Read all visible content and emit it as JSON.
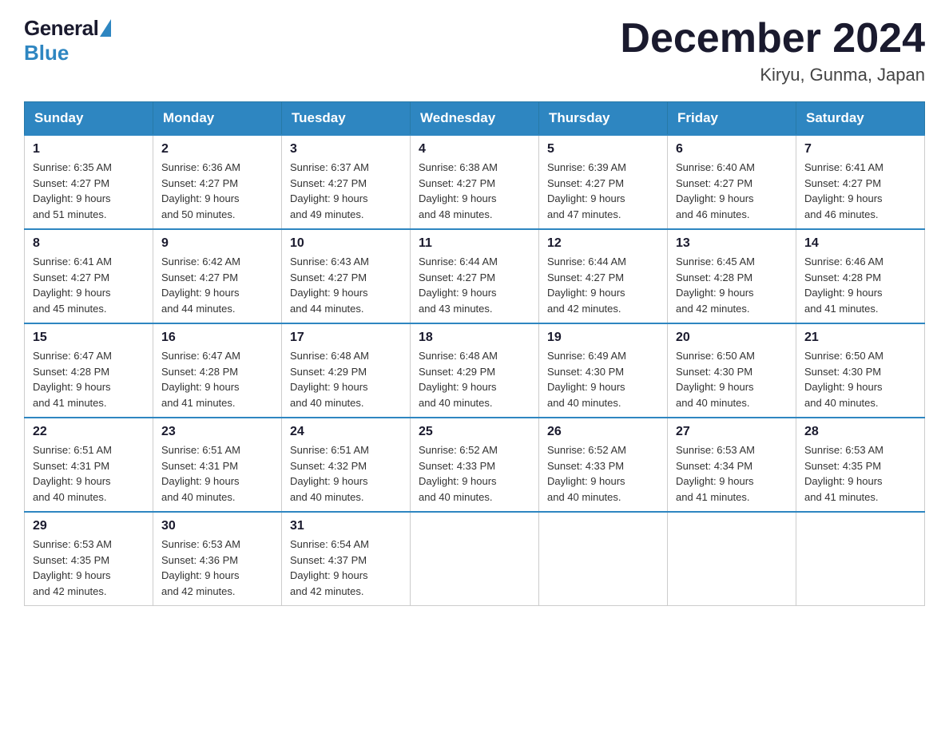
{
  "logo": {
    "general": "General",
    "blue": "Blue"
  },
  "header": {
    "title": "December 2024",
    "location": "Kiryu, Gunma, Japan"
  },
  "weekdays": [
    "Sunday",
    "Monday",
    "Tuesday",
    "Wednesday",
    "Thursday",
    "Friday",
    "Saturday"
  ],
  "weeks": [
    [
      {
        "day": "1",
        "sunrise": "6:35 AM",
        "sunset": "4:27 PM",
        "daylight": "9 hours and 51 minutes."
      },
      {
        "day": "2",
        "sunrise": "6:36 AM",
        "sunset": "4:27 PM",
        "daylight": "9 hours and 50 minutes."
      },
      {
        "day": "3",
        "sunrise": "6:37 AM",
        "sunset": "4:27 PM",
        "daylight": "9 hours and 49 minutes."
      },
      {
        "day": "4",
        "sunrise": "6:38 AM",
        "sunset": "4:27 PM",
        "daylight": "9 hours and 48 minutes."
      },
      {
        "day": "5",
        "sunrise": "6:39 AM",
        "sunset": "4:27 PM",
        "daylight": "9 hours and 47 minutes."
      },
      {
        "day": "6",
        "sunrise": "6:40 AM",
        "sunset": "4:27 PM",
        "daylight": "9 hours and 46 minutes."
      },
      {
        "day": "7",
        "sunrise": "6:41 AM",
        "sunset": "4:27 PM",
        "daylight": "9 hours and 46 minutes."
      }
    ],
    [
      {
        "day": "8",
        "sunrise": "6:41 AM",
        "sunset": "4:27 PM",
        "daylight": "9 hours and 45 minutes."
      },
      {
        "day": "9",
        "sunrise": "6:42 AM",
        "sunset": "4:27 PM",
        "daylight": "9 hours and 44 minutes."
      },
      {
        "day": "10",
        "sunrise": "6:43 AM",
        "sunset": "4:27 PM",
        "daylight": "9 hours and 44 minutes."
      },
      {
        "day": "11",
        "sunrise": "6:44 AM",
        "sunset": "4:27 PM",
        "daylight": "9 hours and 43 minutes."
      },
      {
        "day": "12",
        "sunrise": "6:44 AM",
        "sunset": "4:27 PM",
        "daylight": "9 hours and 42 minutes."
      },
      {
        "day": "13",
        "sunrise": "6:45 AM",
        "sunset": "4:28 PM",
        "daylight": "9 hours and 42 minutes."
      },
      {
        "day": "14",
        "sunrise": "6:46 AM",
        "sunset": "4:28 PM",
        "daylight": "9 hours and 41 minutes."
      }
    ],
    [
      {
        "day": "15",
        "sunrise": "6:47 AM",
        "sunset": "4:28 PM",
        "daylight": "9 hours and 41 minutes."
      },
      {
        "day": "16",
        "sunrise": "6:47 AM",
        "sunset": "4:28 PM",
        "daylight": "9 hours and 41 minutes."
      },
      {
        "day": "17",
        "sunrise": "6:48 AM",
        "sunset": "4:29 PM",
        "daylight": "9 hours and 40 minutes."
      },
      {
        "day": "18",
        "sunrise": "6:48 AM",
        "sunset": "4:29 PM",
        "daylight": "9 hours and 40 minutes."
      },
      {
        "day": "19",
        "sunrise": "6:49 AM",
        "sunset": "4:30 PM",
        "daylight": "9 hours and 40 minutes."
      },
      {
        "day": "20",
        "sunrise": "6:50 AM",
        "sunset": "4:30 PM",
        "daylight": "9 hours and 40 minutes."
      },
      {
        "day": "21",
        "sunrise": "6:50 AM",
        "sunset": "4:30 PM",
        "daylight": "9 hours and 40 minutes."
      }
    ],
    [
      {
        "day": "22",
        "sunrise": "6:51 AM",
        "sunset": "4:31 PM",
        "daylight": "9 hours and 40 minutes."
      },
      {
        "day": "23",
        "sunrise": "6:51 AM",
        "sunset": "4:31 PM",
        "daylight": "9 hours and 40 minutes."
      },
      {
        "day": "24",
        "sunrise": "6:51 AM",
        "sunset": "4:32 PM",
        "daylight": "9 hours and 40 minutes."
      },
      {
        "day": "25",
        "sunrise": "6:52 AM",
        "sunset": "4:33 PM",
        "daylight": "9 hours and 40 minutes."
      },
      {
        "day": "26",
        "sunrise": "6:52 AM",
        "sunset": "4:33 PM",
        "daylight": "9 hours and 40 minutes."
      },
      {
        "day": "27",
        "sunrise": "6:53 AM",
        "sunset": "4:34 PM",
        "daylight": "9 hours and 41 minutes."
      },
      {
        "day": "28",
        "sunrise": "6:53 AM",
        "sunset": "4:35 PM",
        "daylight": "9 hours and 41 minutes."
      }
    ],
    [
      {
        "day": "29",
        "sunrise": "6:53 AM",
        "sunset": "4:35 PM",
        "daylight": "9 hours and 42 minutes."
      },
      {
        "day": "30",
        "sunrise": "6:53 AM",
        "sunset": "4:36 PM",
        "daylight": "9 hours and 42 minutes."
      },
      {
        "day": "31",
        "sunrise": "6:54 AM",
        "sunset": "4:37 PM",
        "daylight": "9 hours and 42 minutes."
      },
      null,
      null,
      null,
      null
    ]
  ],
  "labels": {
    "sunrise": "Sunrise: ",
    "sunset": "Sunset: ",
    "daylight": "Daylight: "
  }
}
